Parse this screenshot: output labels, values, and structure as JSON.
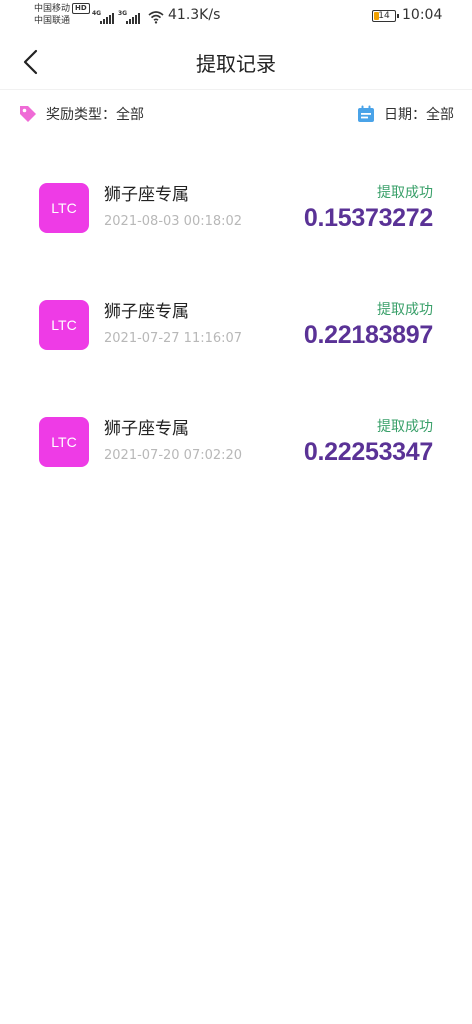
{
  "status_bar": {
    "carrier_1": "中国移动",
    "hd_badge": "HD",
    "carrier_2": "中国联通",
    "signal_1_tag": "4G",
    "signal_2_tag": "3G",
    "net_speed": "41.3K/s",
    "battery": "14",
    "time": "10:04"
  },
  "header": {
    "back_icon": "chevron-left-icon",
    "title": "提取记录"
  },
  "filters": {
    "reward_type": "奖励类型：全部",
    "reward_icon": "tag-icon",
    "date": "日期：全部",
    "date_icon": "calendar-icon"
  },
  "colors": {
    "coin_bg": "#ee3be6",
    "status_green": "#3aa06a",
    "amount_purple": "#5a3296",
    "tag_pink": "#ef6bd6",
    "calendar_blue": "#4aa3e8"
  },
  "records": [
    {
      "coin": "LTC",
      "name": "狮子座专属",
      "date": "2021-08-03 00:18:02",
      "status": "提取成功",
      "amount": "0.15373272"
    },
    {
      "coin": "LTC",
      "name": "狮子座专属",
      "date": "2021-07-27 11:16:07",
      "status": "提取成功",
      "amount": "0.22183897"
    },
    {
      "coin": "LTC",
      "name": "狮子座专属",
      "date": "2021-07-20 07:02:20",
      "status": "提取成功",
      "amount": "0.22253347"
    }
  ]
}
